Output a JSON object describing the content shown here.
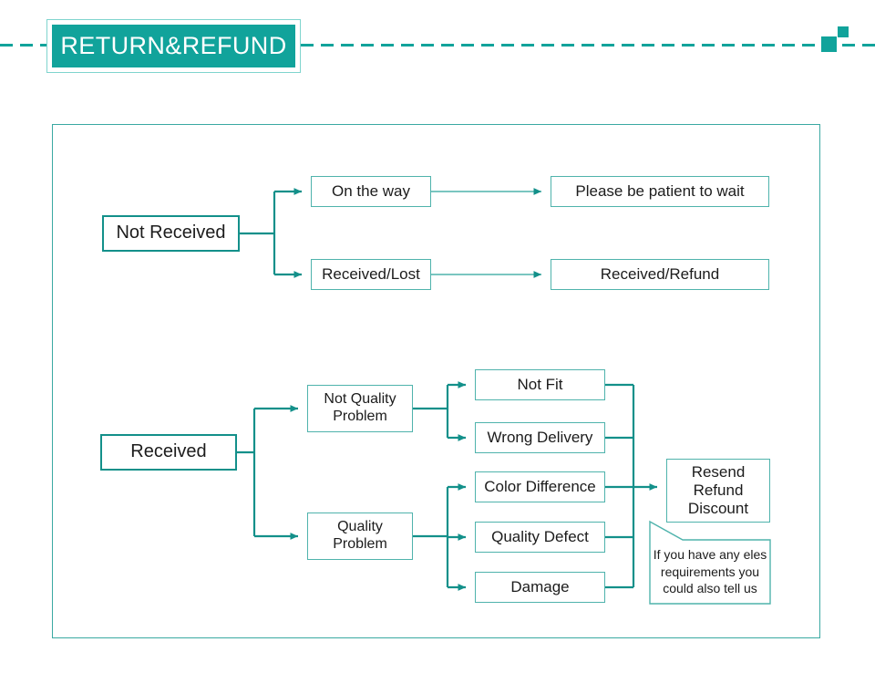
{
  "header": {
    "title": "RETURN&REFUND",
    "accent_color": "#11a39b",
    "banner_border_color": "#7fd4ce",
    "dash_color": "#11a39b"
  },
  "flowchart": {
    "frame_border_color": "#3aa9a2",
    "branch_not_received": {
      "root": "Not Received",
      "stages": [
        {
          "condition": "On the way",
          "outcome": "Please be patient to wait"
        },
        {
          "condition": "Received/Lost",
          "outcome": "Received/Refund"
        }
      ]
    },
    "branch_received": {
      "root": "Received",
      "groups": [
        {
          "label": "Not Quality\nProblem",
          "label_line1": "Not Quality",
          "label_line2": "Problem",
          "reasons": [
            "Not Fit",
            "Wrong Delivery"
          ]
        },
        {
          "label": "Quality\nProblem",
          "label_line1": "Quality",
          "label_line2": "Problem",
          "reasons": [
            "Color Difference",
            "Quality Defect",
            "Damage"
          ]
        }
      ],
      "outcome": {
        "line1": "Resend",
        "line2": "Refund",
        "line3": "Discount"
      }
    },
    "callout": {
      "line1": "If you have any eles",
      "line2": "requirements you",
      "line3": "could also tell us"
    }
  }
}
